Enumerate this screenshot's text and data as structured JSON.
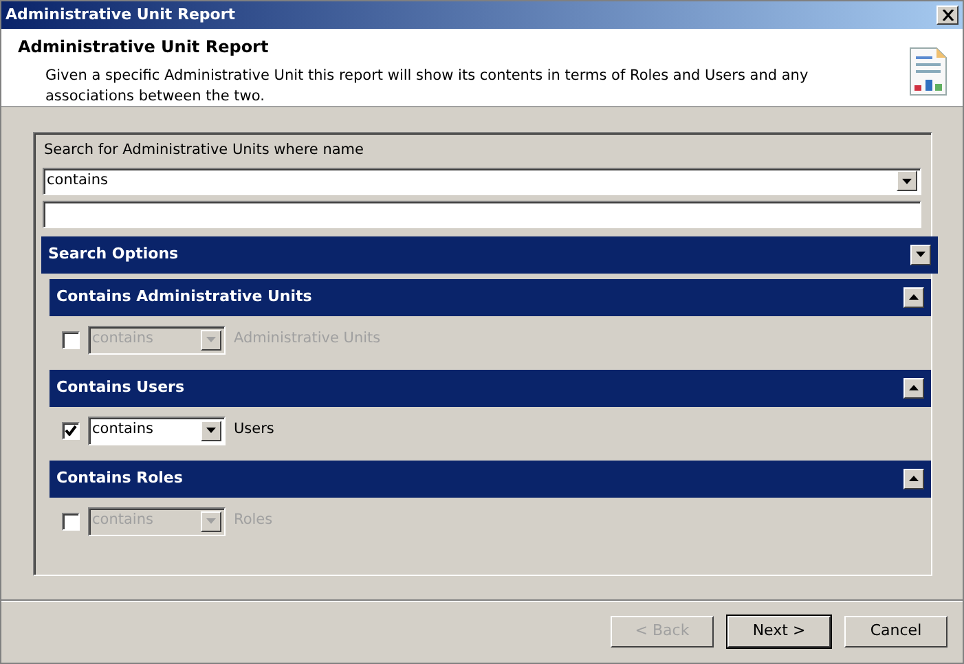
{
  "window": {
    "title": "Administrative Unit Report"
  },
  "header": {
    "title": "Administrative Unit Report",
    "description": "Given a specific Administrative Unit this report will show its contents in terms of Roles and Users and any associations between the two."
  },
  "search": {
    "label": "Search for Administrative Units where name",
    "operator": "contains"
  },
  "search_options": {
    "title": "Search Options",
    "expanded": false
  },
  "sections": [
    {
      "title": "Contains Administrative Units",
      "expanded": true,
      "checked": false,
      "disabled": true,
      "operator": "contains",
      "label": "Administrative Units"
    },
    {
      "title": "Contains Users",
      "expanded": true,
      "checked": true,
      "disabled": false,
      "operator": "contains",
      "label": "Users"
    },
    {
      "title": "Contains Roles",
      "expanded": true,
      "checked": false,
      "disabled": true,
      "operator": "contains",
      "label": "Roles"
    }
  ],
  "buttons": [
    {
      "label": "< Back",
      "disabled": true,
      "default": false
    },
    {
      "label": "Next >",
      "disabled": false,
      "default": true
    },
    {
      "label": "Cancel",
      "disabled": false,
      "default": false
    }
  ]
}
